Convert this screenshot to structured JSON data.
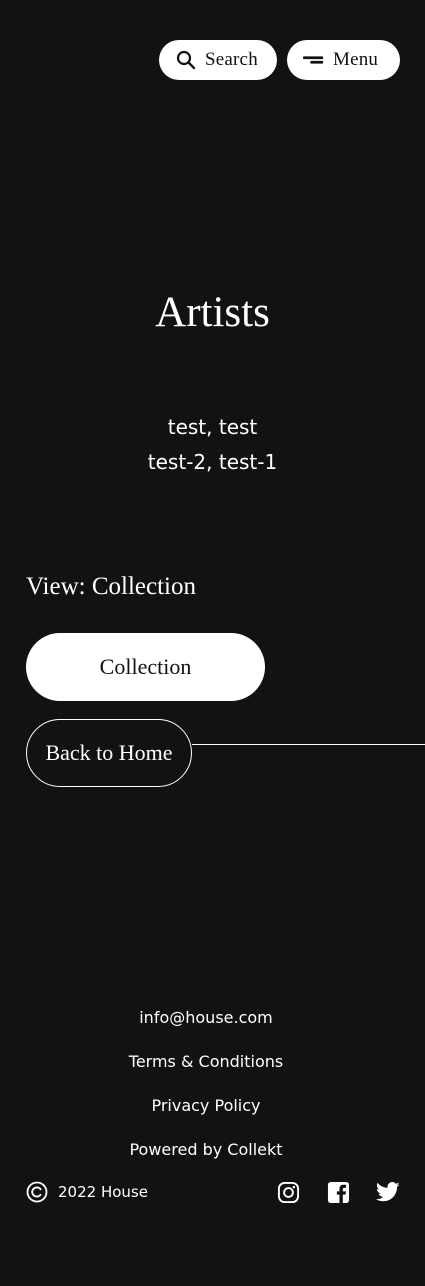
{
  "header": {
    "search_label": "Search",
    "menu_label": "Menu"
  },
  "page": {
    "title": "Artists",
    "artists": [
      "test, test",
      "test-2, test-1"
    ],
    "view_label": "View: Collection"
  },
  "buttons": {
    "collection_label": "Collection",
    "back_home_label": "Back to Home"
  },
  "footer": {
    "links": [
      "info@house.com",
      "Terms & Conditions",
      "Privacy Policy",
      "Powered by Collekt"
    ],
    "copyright_text": "2022 House",
    "social_icons": [
      "instagram-icon",
      "facebook-icon",
      "twitter-icon"
    ]
  },
  "colors": {
    "background": "#121212",
    "foreground": "#ffffff",
    "pill_text": "#111111"
  }
}
